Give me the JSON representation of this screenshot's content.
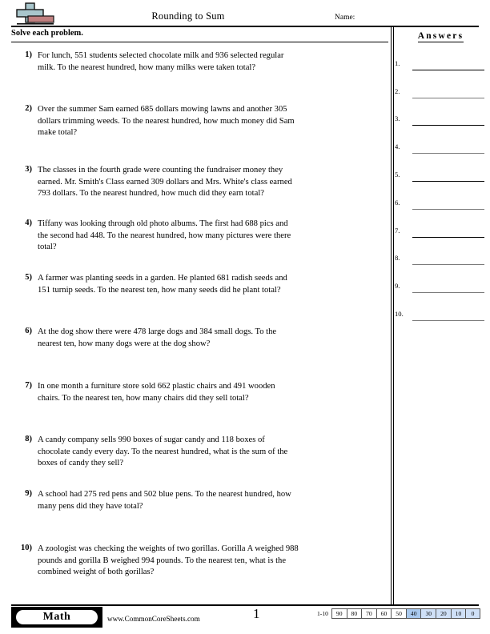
{
  "header": {
    "title": "Rounding to Sum",
    "name_label": "Name:",
    "logo": "plus-eraser-logo"
  },
  "instruction": "Solve each problem.",
  "problems": [
    {
      "num": "1)",
      "text": "For lunch, 551 students selected chocolate milk and 936 selected regular milk. To the nearest hundred, how many milks were taken total?"
    },
    {
      "num": "2)",
      "text": "Over the summer Sam earned 685 dollars mowing lawns and another 305 dollars trimming weeds. To the nearest hundred, how much money did Sam make total?"
    },
    {
      "num": "3)",
      "text": "The classes in the fourth grade were counting the fundraiser money they earned. Mr. Smith's Class earned 309 dollars and Mrs. White's class earned 793 dollars. To the nearest hundred, how much did they earn total?"
    },
    {
      "num": "4)",
      "text": "Tiffany was looking through old photo albums. The first had 688 pics and the second had 448. To the nearest hundred, how many pictures were there total?"
    },
    {
      "num": "5)",
      "text": "A farmer was planting seeds in a garden. He planted 681 radish seeds and 151 turnip seeds. To the nearest ten, how many seeds did he plant total?"
    },
    {
      "num": "6)",
      "text": "At the dog show there were 478 large dogs and 384 small dogs. To the nearest ten, how many dogs were at the dog show?"
    },
    {
      "num": "7)",
      "text": "In one month a furniture store sold 662 plastic chairs and 491 wooden chairs. To the nearest ten, how many chairs did they sell total?"
    },
    {
      "num": "8)",
      "text": "A candy company sells 990 boxes of sugar candy and 118 boxes of chocolate candy every day. To the nearest hundred, what is the sum of the boxes of candy they sell?"
    },
    {
      "num": "9)",
      "text": "A school had 275 red pens and 502 blue pens. To the nearest hundred, how many pens did they have total?"
    },
    {
      "num": "10)",
      "text": "A zoologist was checking the weights of two gorillas. Gorilla A weighed 988 pounds and gorilla B weighed 994 pounds. To the nearest ten, what is the combined weight of both gorillas?"
    }
  ],
  "answers": {
    "heading": "Answers",
    "rows": [
      {
        "label": "1.",
        "line": "dark"
      },
      {
        "label": "2.",
        "line": "gray"
      },
      {
        "label": "3.",
        "line": "dark"
      },
      {
        "label": "4.",
        "line": "gray"
      },
      {
        "label": "5.",
        "line": "dark"
      },
      {
        "label": "6.",
        "line": "gray"
      },
      {
        "label": "7.",
        "line": "dark"
      },
      {
        "label": "8.",
        "line": "gray"
      },
      {
        "label": "9.",
        "line": "gray"
      },
      {
        "label": "10.",
        "line": "gray"
      }
    ]
  },
  "footer": {
    "badge_label": "Math",
    "site_url": "www.CommonCoreSheets.com",
    "page_number": "1",
    "scale_range": "1-10",
    "scale_cells": [
      {
        "value": "90",
        "state": "plain"
      },
      {
        "value": "80",
        "state": "plain"
      },
      {
        "value": "70",
        "state": "plain"
      },
      {
        "value": "60",
        "state": "plain"
      },
      {
        "value": "50",
        "state": "plain"
      },
      {
        "value": "40",
        "state": "selected"
      },
      {
        "value": "30",
        "state": "light"
      },
      {
        "value": "20",
        "state": "light"
      },
      {
        "value": "10",
        "state": "light"
      },
      {
        "value": "0",
        "state": "light"
      }
    ]
  },
  "colors": {
    "scale_selected": "#a9c9ee",
    "scale_light": "#cfe0f7",
    "logo_blue": "#a9c6cc",
    "logo_red": "#c08080",
    "answer_line_gray": "#7a7a7a"
  }
}
